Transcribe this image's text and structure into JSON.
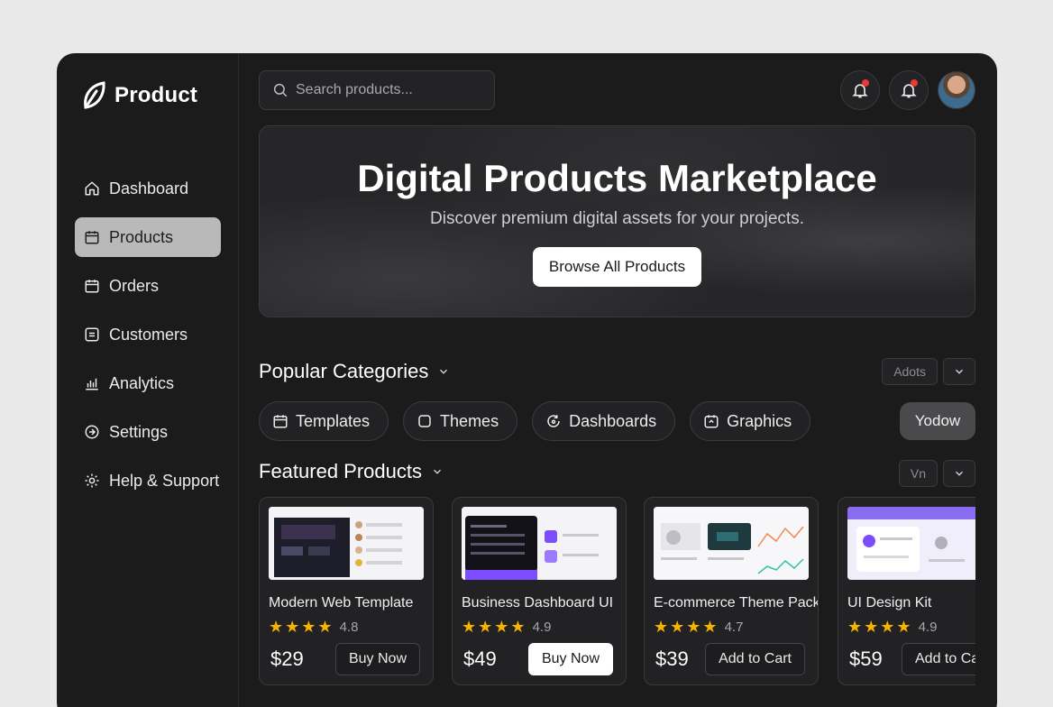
{
  "brand": {
    "name": "Product"
  },
  "sidebar": {
    "items": [
      {
        "label": "Dashboard",
        "icon": "home-icon",
        "active": false
      },
      {
        "label": "Products",
        "icon": "calendar-icon",
        "active": true
      },
      {
        "label": "Orders",
        "icon": "calendar-icon",
        "active": false
      },
      {
        "label": "Customers",
        "icon": "list-icon",
        "active": false
      },
      {
        "label": "Analytics",
        "icon": "bar-chart-icon",
        "active": false
      },
      {
        "label": "Settings",
        "icon": "settings-icon",
        "active": false
      },
      {
        "label": "Help & Support",
        "icon": "gear-icon",
        "active": false
      }
    ]
  },
  "header": {
    "search_placeholder": "Search products...",
    "icons": [
      "bell-icon",
      "bell-icon",
      "avatar"
    ]
  },
  "hero": {
    "title": "Digital Products Marketplace",
    "subtitle": "Discover premium digital assets for your projects.",
    "button": "Browse All Products"
  },
  "categories": {
    "title": "Popular Categories",
    "control_label": "Adots",
    "extra_button": "Yodow",
    "items": [
      {
        "label": "Templates",
        "icon": "calendar-icon"
      },
      {
        "label": "Themes",
        "icon": "square-icon"
      },
      {
        "label": "Dashboards",
        "icon": "refresh-icon"
      },
      {
        "label": "Graphics",
        "icon": "image-icon"
      }
    ]
  },
  "featured": {
    "title": "Featured Products",
    "control_label": "Vn",
    "items": [
      {
        "name": "Modern Web Template",
        "rating": "4.8",
        "stars": 4,
        "price": "$29",
        "button": "Buy Now",
        "primary": false
      },
      {
        "name": "Business Dashboard UI",
        "rating": "4.9",
        "stars": 4,
        "price": "$49",
        "button": "Buy Now",
        "primary": true
      },
      {
        "name": "E-commerce Theme Pack",
        "rating": "4.7",
        "stars": 4,
        "price": "$39",
        "button": "Add to Cart",
        "primary": false
      },
      {
        "name": "UI Design Kit",
        "rating": "4.9",
        "stars": 4,
        "price": "$59",
        "button": "Add to Cart",
        "primary": false
      }
    ]
  },
  "colors": {
    "accent": "#ffffff",
    "background": "#1b1b1c",
    "star": "#f5b400",
    "notification": "#e53935"
  }
}
